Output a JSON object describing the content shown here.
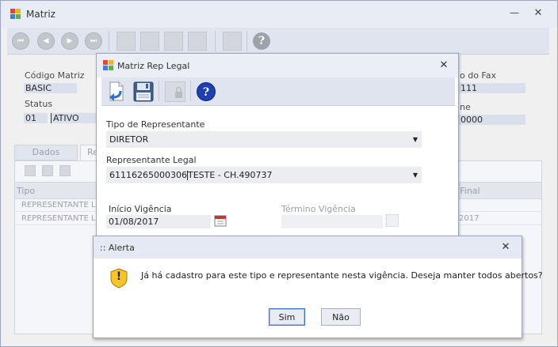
{
  "main": {
    "title": "Matriz",
    "minimize_glyph": "—",
    "close_glyph": "✕",
    "fields": {
      "codigo_label": "Código Matriz",
      "codigo_value": "BASIC",
      "status_label": "Status",
      "status_code": "01",
      "status_value": "ATIVO",
      "fax_label": "o do Fax",
      "fax_value": "111",
      "phone_label": "ne",
      "phone_value": "0000"
    },
    "tabs": [
      {
        "label": "Dados Básicos"
      },
      {
        "label": "Re"
      }
    ],
    "grid": {
      "headers": [
        "Tipo",
        "a Final"
      ],
      "rows": [
        {
          "tipo": "REPRESENTANTE LI",
          "final": ""
        },
        {
          "tipo": "REPRESENTANTE LI",
          "final": "2017"
        }
      ]
    }
  },
  "rep_dialog": {
    "title": "Matriz Rep Legal",
    "close_glyph": "✕",
    "tipo_label": "Tipo de Representante",
    "tipo_value": "DIRETOR",
    "rep_label": "Representante Legal",
    "rep_value": "61116265000306",
    "rep_value_rest": "TESTE - CH.490737",
    "inicio_label": "Início Vigência",
    "inicio_value": "01/08/2017",
    "termino_label": "Término Vigência",
    "termino_value": "",
    "dropdown_glyph": "▼"
  },
  "alert": {
    "title": ":: Alerta",
    "close_glyph": "✕",
    "message": "Já há cadastro para este tipo e representante nesta vigência. Deseja manter todos abertos?",
    "buttons": {
      "yes": "Sim",
      "no": "Não"
    },
    "warning_glyph": "!"
  },
  "icons": {
    "help_glyph": "?",
    "nav_first": "⏮",
    "nav_prev": "◀",
    "nav_next": "▶",
    "nav_last": "⏭"
  },
  "colors": {
    "help_blue": "#1f3fae",
    "warning_yellow": "#f7c42b",
    "calendar_red": "#c0392b",
    "toolbar_bg": "#dfe4ef"
  }
}
